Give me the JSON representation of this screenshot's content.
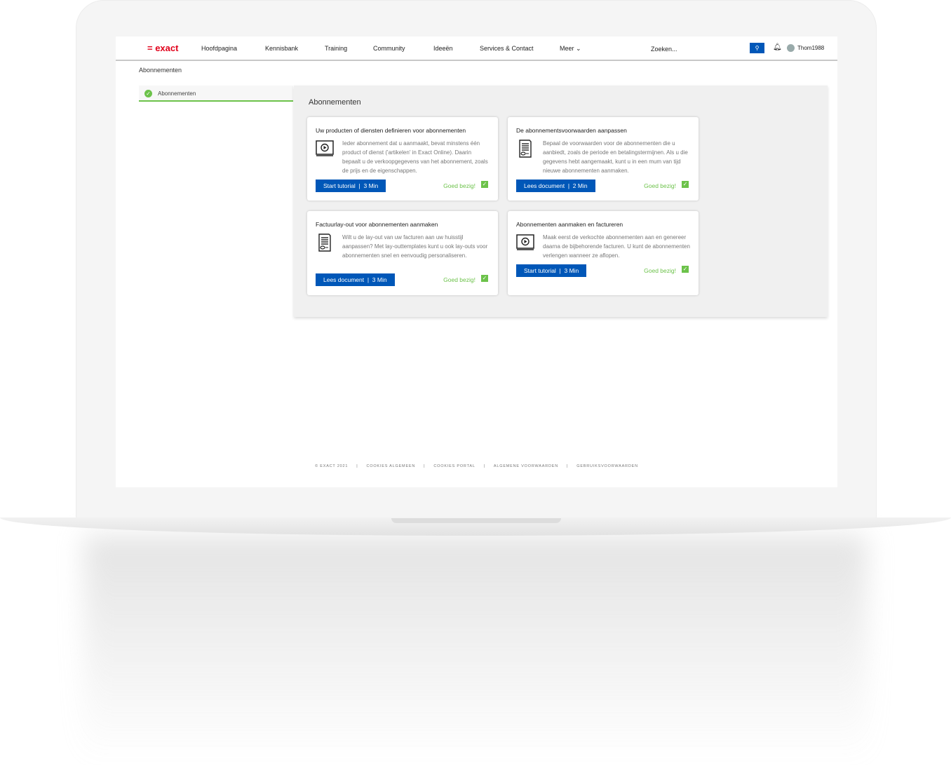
{
  "nav": {
    "logo": "= exact",
    "items": [
      "Hoofdpagina",
      "Kennisbank",
      "Training",
      "Community",
      "Ideeën",
      "Services & Contact",
      "Meer"
    ],
    "search_placeholder": "Zoeken...",
    "user": "Thom1988"
  },
  "breadcrumb": "Abonnementen",
  "sidebar": {
    "item": "Abonnementen",
    "status": "completed"
  },
  "panel_title": "Abonnementen",
  "cards": [
    {
      "title": "Uw producten of diensten definieren voor abonnementen",
      "icon": "video-icon",
      "text": "Ieder abonnement dat u aanmaakt, bevat minstens één product of dienst ('artikelen' in Exact Online). Daarin bepaalt u de verkoopgegevens van het abonnement, zoals de prijs en de eigenschappen.",
      "button": "Start tutorial  |  3 Min",
      "status": "Goed bezig!"
    },
    {
      "title": "De abonnementsvoorwaarden aanpassen",
      "icon": "document-icon",
      "text": "Bepaal de voorwaarden voor de abonnementen die u aanbiedt, zoals de periode en betalingstermijnen. Als u die gegevens hebt aangemaakt, kunt u in een mum van tijd nieuwe abonnementen aanmaken.",
      "button": "Lees document  |  2 Min",
      "status": "Goed bezig!"
    },
    {
      "title": "Factuurlay-out voor abonnementen aanmaken",
      "icon": "document-icon",
      "text": "Wilt u de lay-out van uw facturen aan uw huisstijl aanpassen? Met lay-outtemplates kunt u ook lay-outs voor abonnementen snel en eenvoudig personaliseren.",
      "button": "Lees document  |  3 Min",
      "status": "Goed bezig!"
    },
    {
      "title": "Abonnementen aanmaken en factureren",
      "icon": "video-icon",
      "text": "Maak eerst de verkochte abonnementen aan en genereer daarna de bijbehorende facturen. U kunt de abonnementen verlengen wanneer ze aflopen.",
      "button": "Start tutorial  |  3 Min",
      "status": "Goed bezig!"
    }
  ],
  "footer": [
    "© EXACT 2021",
    "|",
    "COOKIES ALGEMEEN",
    "|",
    "COOKIES PORTAL",
    "|",
    "ALGEMENE VOORWAARDEN",
    "|",
    "GEBRUIKSVOORWAARDEN"
  ],
  "colors": {
    "brand": "#e1001a",
    "primary": "#0057b8",
    "success": "#6cc24a"
  }
}
